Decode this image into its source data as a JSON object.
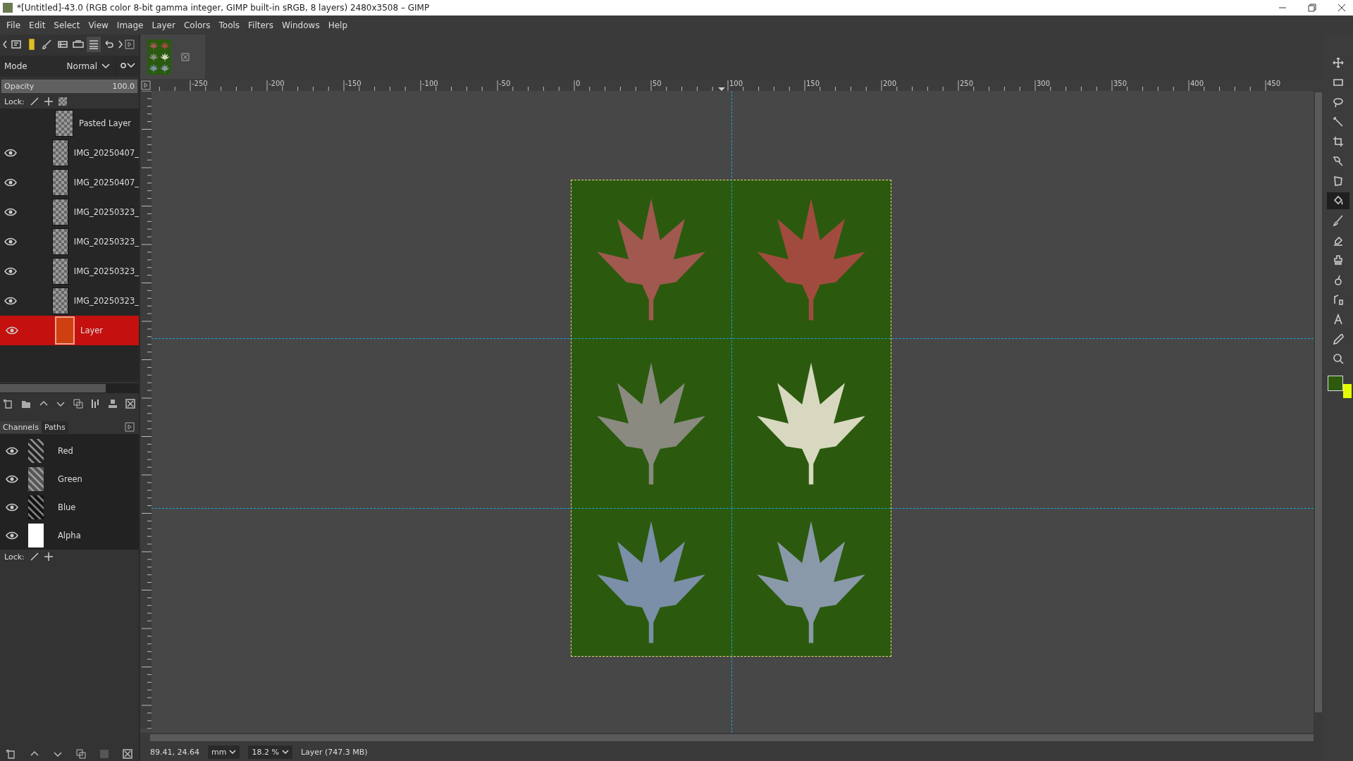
{
  "window": {
    "title": "*[Untitled]-43.0 (RGB color 8-bit gamma integer, GIMP built-in sRGB, 8 layers) 2480x3508 – GIMP"
  },
  "menu": [
    "File",
    "Edit",
    "Select",
    "View",
    "Image",
    "Layer",
    "Colors",
    "Tools",
    "Filters",
    "Windows",
    "Help"
  ],
  "dock_tabs": [
    {
      "kind": "options",
      "selected": false
    },
    {
      "kind": "device",
      "selected": false
    },
    {
      "kind": "brush",
      "selected": false
    },
    {
      "kind": "pattern",
      "selected": false
    },
    {
      "kind": "images",
      "selected": false
    },
    {
      "kind": "layers",
      "selected": true
    },
    {
      "kind": "undo",
      "selected": false
    }
  ],
  "layers_panel": {
    "mode_label": "Mode",
    "mode": "Normal",
    "opacity_label": "Opacity",
    "opacity": "100.0",
    "level": 1.0,
    "lock_label": "Lock:",
    "layers": [
      {
        "name": "Pasted Layer",
        "visible": false,
        "selected": false,
        "kind": "image"
      },
      {
        "name": "IMG_20250407_",
        "visible": true,
        "selected": false,
        "kind": "image"
      },
      {
        "name": "IMG_20250407_",
        "visible": true,
        "selected": false,
        "kind": "image"
      },
      {
        "name": "IMG_20250323_",
        "visible": true,
        "selected": false,
        "kind": "image"
      },
      {
        "name": "IMG_20250323_",
        "visible": true,
        "selected": false,
        "kind": "image"
      },
      {
        "name": "IMG_20250323_",
        "visible": true,
        "selected": false,
        "kind": "image"
      },
      {
        "name": "IMG_20250323_",
        "visible": true,
        "selected": false,
        "kind": "image"
      },
      {
        "name": "Layer",
        "visible": true,
        "selected": true,
        "kind": "fill"
      }
    ]
  },
  "channels_panel": {
    "tabs": [
      {
        "label": "Channels",
        "selected": true
      },
      {
        "label": "Paths",
        "selected": false
      }
    ],
    "lock_label": "Lock:",
    "channels": [
      {
        "name": "Red",
        "visible": true,
        "kind": "color"
      },
      {
        "name": "Green",
        "visible": true,
        "kind": "color"
      },
      {
        "name": "Blue",
        "visible": true,
        "kind": "color"
      },
      {
        "name": "Alpha",
        "visible": true,
        "kind": "alpha"
      }
    ]
  },
  "ruler": {
    "labels": [
      "-250",
      "-200",
      "-150",
      "-100",
      "-50",
      "0",
      "50",
      "100",
      "150",
      "200",
      "250",
      "300",
      "350",
      "400",
      "450"
    ]
  },
  "tools": [
    {
      "kind": "move",
      "selected": false
    },
    {
      "kind": "rect-select",
      "selected": false
    },
    {
      "kind": "lasso",
      "selected": false
    },
    {
      "kind": "fuzzy-select",
      "selected": false
    },
    {
      "kind": "crop",
      "selected": false
    },
    {
      "kind": "transform",
      "selected": false
    },
    {
      "kind": "perspective",
      "selected": false
    },
    {
      "kind": "bucket-fill",
      "selected": true
    },
    {
      "kind": "paintbrush",
      "selected": false
    },
    {
      "kind": "eraser",
      "selected": false
    },
    {
      "kind": "clone",
      "selected": false
    },
    {
      "kind": "smudge",
      "selected": false
    },
    {
      "kind": "paths",
      "selected": false
    },
    {
      "kind": "text",
      "selected": false
    },
    {
      "kind": "color-picker",
      "selected": false
    },
    {
      "kind": "zoom",
      "selected": false
    }
  ],
  "colors": [
    {
      "kind": "foreground",
      "color": "#2d5a0f"
    },
    {
      "kind": "background",
      "color": "#e6ff00"
    }
  ],
  "status_bar": {
    "coordinates": "89.41, 24.64",
    "unit": "mm",
    "zoom": "18.2 %",
    "message": "Layer (747.3 MB)"
  }
}
